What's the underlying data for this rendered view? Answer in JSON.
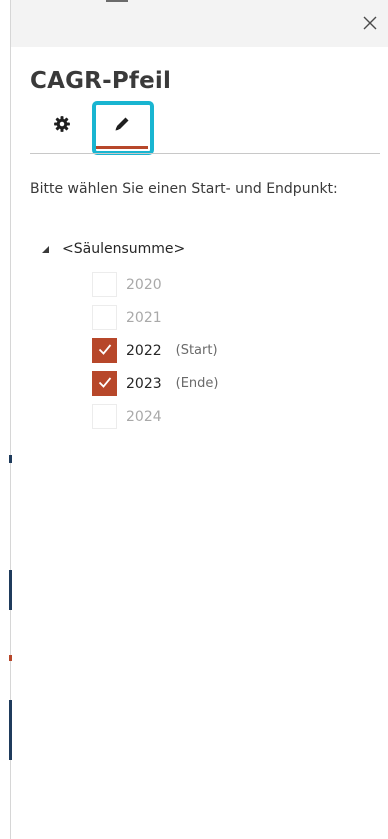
{
  "pane": {
    "title": "CAGR-Pfeil",
    "close_icon": "close-icon"
  },
  "tabs": [
    {
      "name": "settings",
      "icon": "gear-icon"
    },
    {
      "name": "edit",
      "icon": "pencil-icon",
      "selected": true,
      "focused": true
    }
  ],
  "instruction": "Bitte wählen Sie einen Start- und Endpunkt:",
  "tree": {
    "root_label": "<Säulensumme>",
    "expanded": true,
    "items": [
      {
        "year": "2020",
        "checked": false,
        "enabled": false,
        "note": ""
      },
      {
        "year": "2021",
        "checked": false,
        "enabled": false,
        "note": ""
      },
      {
        "year": "2022",
        "checked": true,
        "enabled": true,
        "note": "(Start)"
      },
      {
        "year": "2023",
        "checked": true,
        "enabled": true,
        "note": "(Ende)"
      },
      {
        "year": "2024",
        "checked": false,
        "enabled": false,
        "note": ""
      }
    ]
  },
  "colors": {
    "accent": "#b7472a",
    "focus_ring": "#19b5d1",
    "titlebar_bg": "#f3f3f3"
  }
}
